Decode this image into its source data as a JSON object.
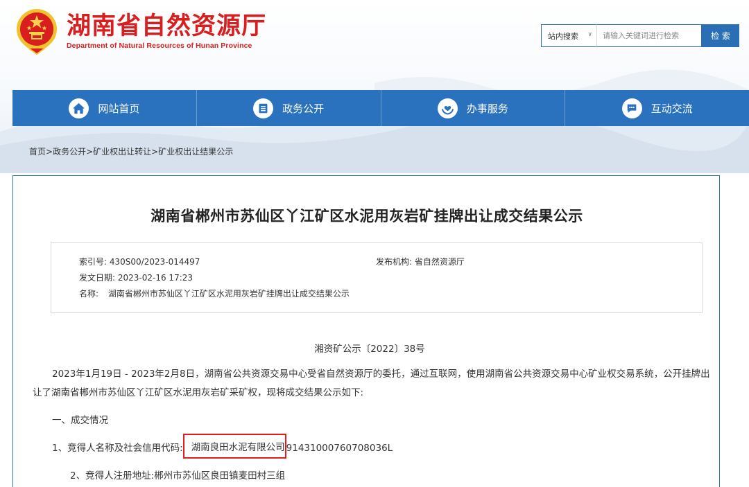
{
  "site": {
    "title_cn": "湖南省自然资源厅",
    "title_en": "Department of Natural Resources of Hunan Province",
    "colors": {
      "brand_red": "#d81e1e",
      "nav_blue": "#2a72bd"
    }
  },
  "search": {
    "scope": "站内搜索",
    "placeholder": "请输入关键词进行检索",
    "button": "检 索"
  },
  "nav": {
    "items": [
      {
        "label": "网站首页",
        "icon": "home-icon"
      },
      {
        "label": "政务公开",
        "icon": "document-list-icon"
      },
      {
        "label": "办事服务",
        "icon": "hands-heart-icon"
      },
      {
        "label": "互动交流",
        "icon": "chat-bubble-icon"
      }
    ]
  },
  "breadcrumb": {
    "items": [
      "首页",
      "政务公开",
      "矿业权出让转让",
      "矿业权出让结果公示"
    ],
    "separator": ">"
  },
  "article": {
    "title": "湖南省郴州市苏仙区丫江矿区水泥用灰岩矿挂牌出让成交结果公示",
    "meta": {
      "index_label": "索引号:",
      "index_value": "430S00/2023-014497",
      "publisher_label": "发布机构:",
      "publisher_value": "省自然资源厅",
      "date_label": "发文日期:",
      "date_value": "2023-02-16 17:23",
      "name_label": "名称:",
      "name_value": "湖南省郴州市苏仙区丫江矿区水泥用灰岩矿挂牌出让成交结果公示"
    },
    "doc_number": "湘资矿公示〔2022〕38号",
    "intro": "2023年1月19日 - 2023年2月8日，湖南省公共资源交易中心受省自然资源厅的委托，通过互联网，使用湖南省公共资源交易中心矿业权交易系统，公开挂牌出让了湖南省郴州市苏仙区丫江矿区水泥用灰岩矿采矿权，现将成交结果公示如下:",
    "section1": "一、成交情况",
    "item1_label": "1、竞得人名称及社会信用代码:",
    "item1_company": "湖南良田水泥有限公司",
    "item1_code": "91431000760708036L",
    "item2_label": "2、竞得人注册地址:",
    "item2_value": "郴州市苏仙区良田镇麦田村三组"
  }
}
